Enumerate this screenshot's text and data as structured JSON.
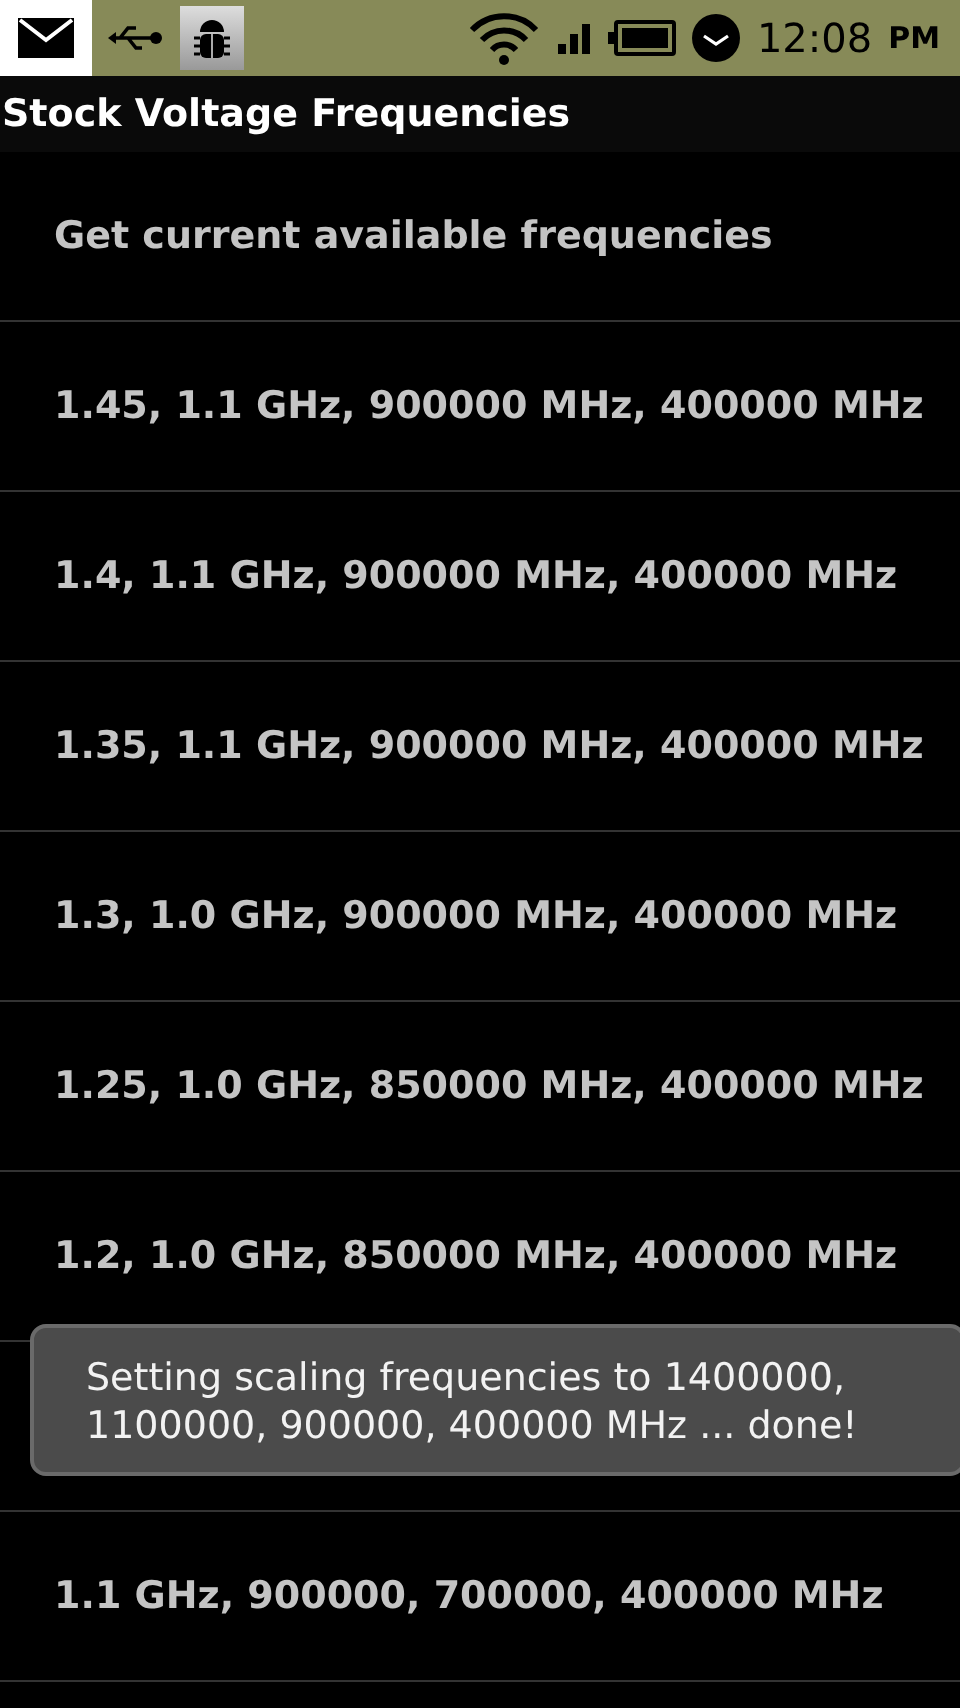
{
  "status_bar": {
    "time": "12:08",
    "ampm": "PM"
  },
  "title": "Stock Voltage Frequencies",
  "items": [
    {
      "label": "Get current available frequencies"
    },
    {
      "label": "1.45, 1.1 GHz, 900000 MHz, 400000 MHz"
    },
    {
      "label": "1.4, 1.1 GHz, 900000 MHz, 400000 MHz"
    },
    {
      "label": "1.35, 1.1 GHz, 900000 MHz, 400000 MHz"
    },
    {
      "label": "1.3, 1.0 GHz, 900000 MHz, 400000 MHz"
    },
    {
      "label": "1.25, 1.0 GHz, 850000 MHz, 400000 MHz"
    },
    {
      "label": "1.2, 1.0 GHz, 850000 MHz, 400000 MHz"
    }
  ],
  "items_after_toast": [
    {
      "label": "1.1 GHz, 900000, 700000, 400000 MHz"
    }
  ],
  "toast": {
    "message": "Setting scaling frequencies to 1400000, 1100000, 900000, 400000 MHz ... done!"
  }
}
